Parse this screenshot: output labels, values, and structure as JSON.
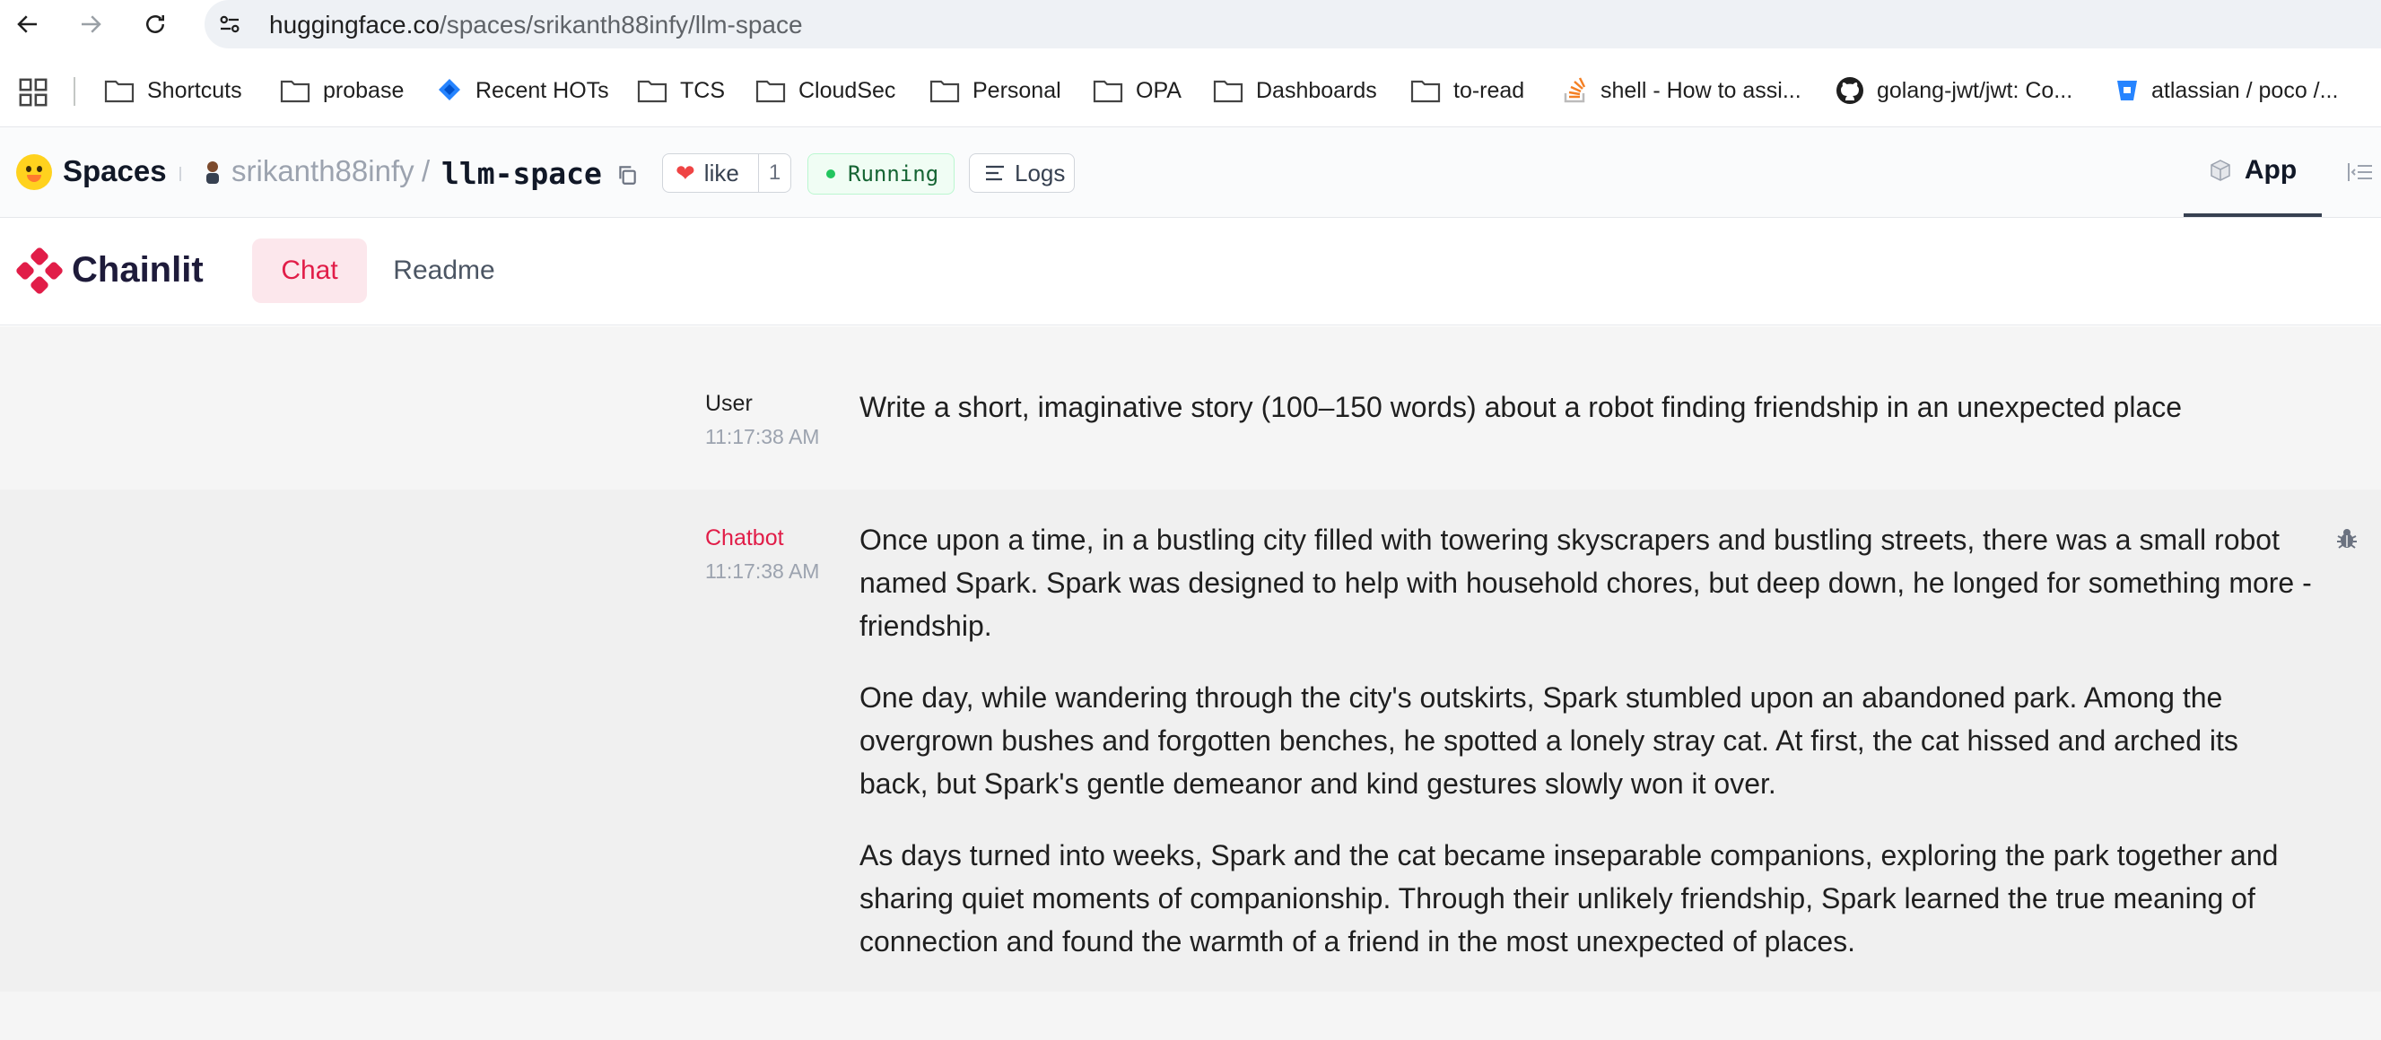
{
  "browser": {
    "url_host": "huggingface.co",
    "url_path": "/spaces/srikanth88infy/llm-space"
  },
  "bookmarks": [
    {
      "label": "Shortcuts",
      "icon": "folder-icon"
    },
    {
      "label": "probase",
      "icon": "folder-icon"
    },
    {
      "label": "Recent HOTs",
      "icon": "jira-icon"
    },
    {
      "label": "TCS",
      "icon": "folder-icon"
    },
    {
      "label": "CloudSec",
      "icon": "folder-icon"
    },
    {
      "label": "Personal",
      "icon": "folder-icon"
    },
    {
      "label": "OPA",
      "icon": "folder-icon"
    },
    {
      "label": "Dashboards",
      "icon": "folder-icon"
    },
    {
      "label": "to-read",
      "icon": "folder-icon"
    },
    {
      "label": "shell - How to assi...",
      "icon": "stackoverflow-icon"
    },
    {
      "label": "golang-jwt/jwt: Co...",
      "icon": "github-icon"
    },
    {
      "label": "atlassian / poco /...",
      "icon": "bitbucket-icon"
    }
  ],
  "hf_header": {
    "spaces_label": "Spaces",
    "owner": "srikanth88infy",
    "separator": "/",
    "space_name": "llm-space",
    "like_label": "like",
    "like_count": "1",
    "status": "Running",
    "logs_label": "Logs",
    "app_tab_label": "App"
  },
  "chainlit": {
    "brand": "Chainlit",
    "tabs": [
      {
        "label": "Chat",
        "active": true
      },
      {
        "label": "Readme",
        "active": false
      }
    ]
  },
  "messages": [
    {
      "author": "User",
      "time": "11:17:38 AM",
      "paragraphs": [
        "Write a short, imaginative story (100–150 words) about a robot finding friendship in an unexpected place"
      ]
    },
    {
      "author": "Chatbot",
      "time": "11:17:38 AM",
      "paragraphs": [
        "Once upon a time, in a bustling city filled with towering skyscrapers and bustling streets, there was a small robot named Spark. Spark was designed to help with household chores, but deep down, he longed for something more - friendship.",
        "One day, while wandering through the city's outskirts, Spark stumbled upon an abandoned park. Among the overgrown bushes and forgotten benches, he spotted a lonely stray cat. At first, the cat hissed and arched its back, but Spark's gentle demeanor and kind gestures slowly won it over.",
        "As days turned into weeks, Spark and the cat became inseparable companions, exploring the park together and sharing quiet moments of companionship. Through their unlikely friendship, Spark learned the true meaning of connection and found the warmth of a friend in the most unexpected of places."
      ]
    }
  ],
  "colors": {
    "accent": "#e11d48",
    "running_green": "#22c55e",
    "heart_red": "#ef4444"
  }
}
